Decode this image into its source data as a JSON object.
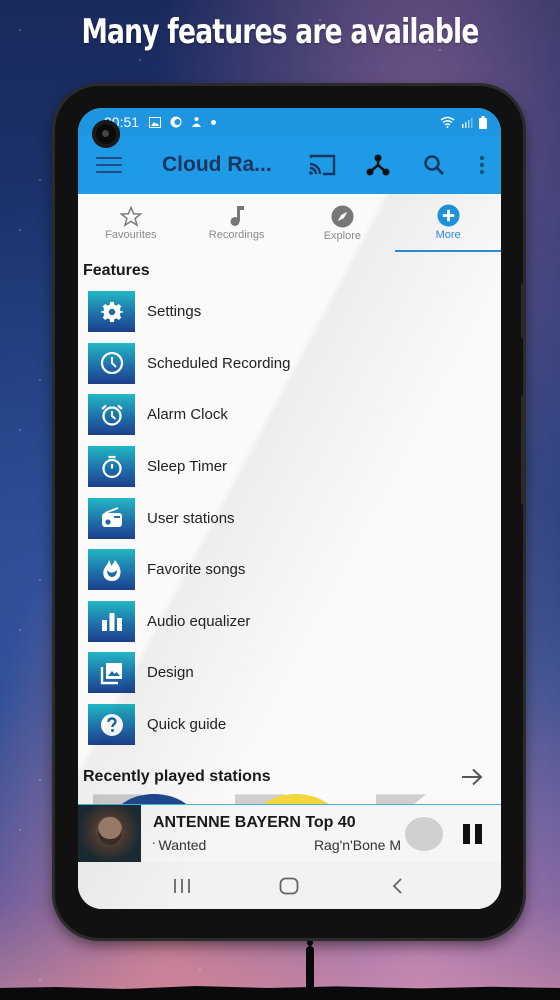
{
  "promo": {
    "headline": "Many features are available"
  },
  "statusbar": {
    "time": "20:51",
    "icons_left": [
      "gallery-icon",
      "c-app-icon",
      "notification-app-icon",
      "dot-icon"
    ],
    "icons_right": [
      "wifi-icon",
      "signal-icon",
      "battery-icon"
    ]
  },
  "appbar": {
    "title": "Cloud Ra...",
    "actions": [
      "cast-icon",
      "network-icon",
      "search-icon",
      "more-vert-icon"
    ],
    "accent_color": "#1e9ae6"
  },
  "tabs": [
    {
      "label": "Favourites",
      "icon": "star-icon",
      "active": false
    },
    {
      "label": "Recordings",
      "icon": "music-note-icon",
      "active": false
    },
    {
      "label": "Explore",
      "icon": "compass-icon",
      "active": false
    },
    {
      "label": "More",
      "icon": "plus-circle-icon",
      "active": true
    }
  ],
  "features": {
    "title": "Features",
    "items": [
      {
        "label": "Settings",
        "icon": "gear-icon"
      },
      {
        "label": "Scheduled Recording",
        "icon": "clock-icon"
      },
      {
        "label": "Alarm Clock",
        "icon": "alarm-clock-icon"
      },
      {
        "label": "Sleep Timer",
        "icon": "stopwatch-icon"
      },
      {
        "label": "User stations",
        "icon": "radio-icon"
      },
      {
        "label": "Favorite songs",
        "icon": "flame-icon"
      },
      {
        "label": "Audio equalizer",
        "icon": "equalizer-icon"
      },
      {
        "label": "Design",
        "icon": "image-stack-icon"
      },
      {
        "label": "Quick guide",
        "icon": "help-icon"
      }
    ]
  },
  "recent": {
    "title": "Recently played stations"
  },
  "player": {
    "station": "ANTENNE BAYERN Top 40",
    "song": "r Wanted",
    "artist": "Rag'n'Bone M"
  }
}
